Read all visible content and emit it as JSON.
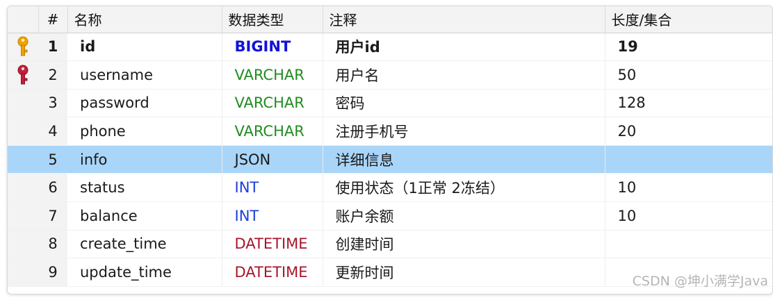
{
  "columns": {
    "num": "#",
    "name": "名称",
    "type": "数据类型",
    "comment": "注释",
    "length": "长度/集合"
  },
  "rows": [
    {
      "num": "1",
      "name": "id",
      "type": "BIGINT",
      "comment": "用户id",
      "length": "19",
      "key": "primary-key-icon"
    },
    {
      "num": "2",
      "name": "username",
      "type": "VARCHAR",
      "comment": "用户名",
      "length": "50",
      "key": "unique-key-icon"
    },
    {
      "num": "3",
      "name": "password",
      "type": "VARCHAR",
      "comment": "密码",
      "length": "128",
      "key": ""
    },
    {
      "num": "4",
      "name": "phone",
      "type": "VARCHAR",
      "comment": "注册手机号",
      "length": "20",
      "key": ""
    },
    {
      "num": "5",
      "name": "info",
      "type": "JSON",
      "comment": "详细信息",
      "length": "",
      "key": "",
      "selected": true
    },
    {
      "num": "6",
      "name": "status",
      "type": "INT",
      "comment": "使用状态（1正常 2冻结）",
      "length": "10",
      "key": ""
    },
    {
      "num": "7",
      "name": "balance",
      "type": "INT",
      "comment": "账户余额",
      "length": "10",
      "key": ""
    },
    {
      "num": "8",
      "name": "create_time",
      "type": "DATETIME",
      "comment": "创建时间",
      "length": "",
      "key": ""
    },
    {
      "num": "9",
      "name": "update_time",
      "type": "DATETIME",
      "comment": "更新时间",
      "length": "",
      "key": ""
    }
  ],
  "colors": {
    "primary_key": "#f0a400",
    "unique_key": "#c21f3a",
    "selected_row": "#a9d5f9",
    "BIGINT": "#1212d6",
    "VARCHAR": "#1f8c1f",
    "INT": "#1b3fd9",
    "DATETIME": "#a8152b"
  },
  "watermark": "CSDN @坤小满学Java"
}
